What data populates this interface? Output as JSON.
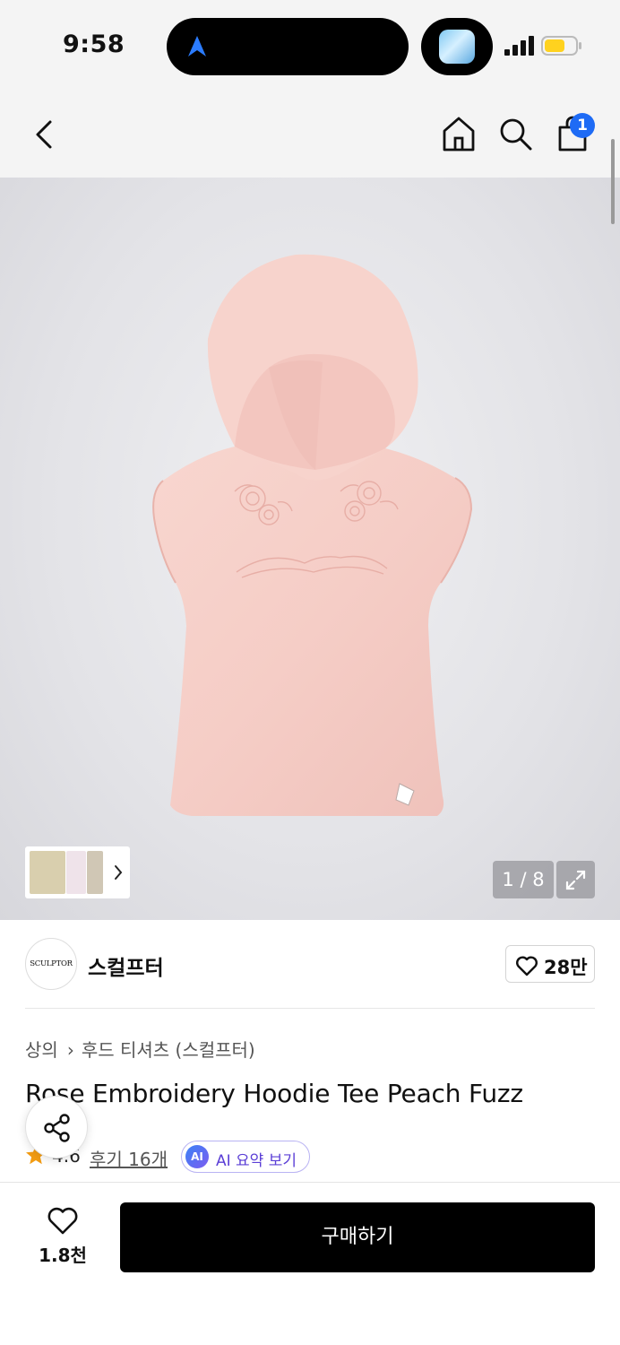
{
  "status_bar": {
    "time": "9:58"
  },
  "top_nav": {
    "cart_count": "1"
  },
  "gallery": {
    "page_counter": "1 / 8"
  },
  "brand": {
    "logo_text": "SCULPTOR",
    "name": "스컬프터",
    "like_count": "28만"
  },
  "product": {
    "breadcrumb": [
      "상의",
      "후드 티셔츠 (스컬프터)"
    ],
    "title": "Rose Embroidery Hoodie Tee Peach Fuzz",
    "rating": "4.6",
    "reviews": "후기 16개",
    "ai_badge": "AI",
    "ai_summary_label": "AI 요약 보기"
  },
  "bottom_bar": {
    "wish_count": "1.8천",
    "buy_label": "구매하기"
  },
  "colors": {
    "accent_blue": "#1e6bf5",
    "star": "#f39c12",
    "ai_purple": "#5b3fd6",
    "garment_pink": "#f6cfc8"
  }
}
